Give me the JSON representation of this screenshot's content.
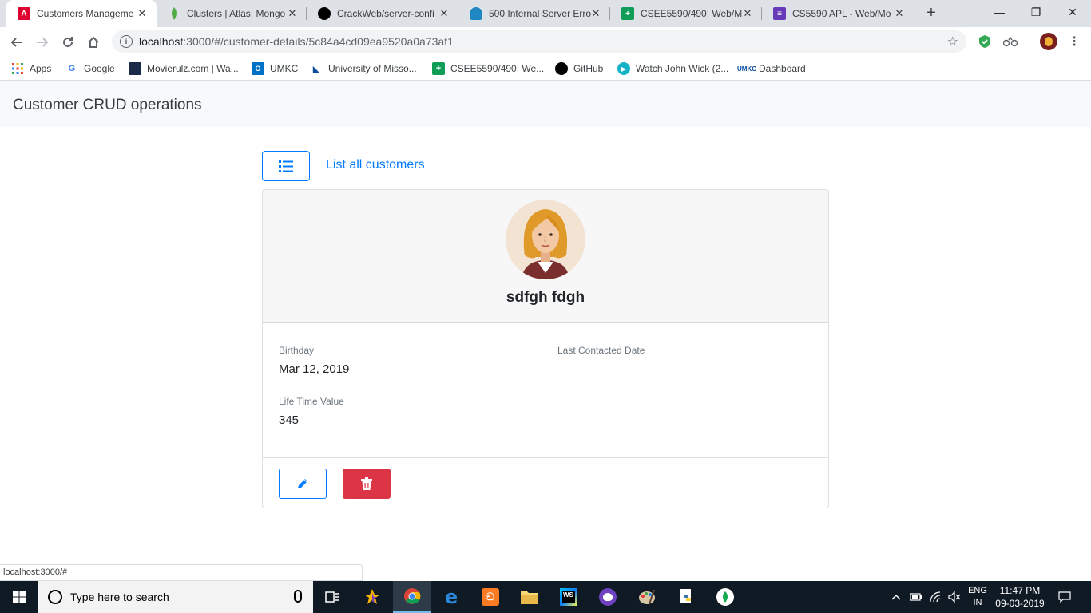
{
  "browser": {
    "tabs": [
      {
        "title": "Customers Manageme",
        "favicon": "angular-icon",
        "color": "#dd0031",
        "active": true
      },
      {
        "title": "Clusters | Atlas: Mongo",
        "favicon": "mongodb-leaf-icon",
        "color": "#4faa41"
      },
      {
        "title": "CrackWeb/server-confi",
        "favicon": "github-icon",
        "color": "#000000"
      },
      {
        "title": "500 Internal Server Erro",
        "favicon": "cloud-icon",
        "color": "#1f88c2"
      },
      {
        "title": "CSEE5590/490: Web/M",
        "favicon": "sheets-icon",
        "color": "#0f9d58"
      },
      {
        "title": "CS5590 APL - Web/Mo",
        "favicon": "forms-icon",
        "color": "#673ab7"
      }
    ],
    "url_host": "localhost",
    "url_rest": ":3000/#/customer-details/5c84a4cd09ea9520a0a73af1",
    "bookmarks": [
      {
        "label": "Apps",
        "icon": "apps-grid-icon"
      },
      {
        "label": "Google",
        "icon": "google-icon"
      },
      {
        "label": "Movierulz.com | Wa...",
        "icon": "movierulz-icon"
      },
      {
        "label": "UMKC",
        "icon": "outlook-icon"
      },
      {
        "label": "University of Misso...",
        "icon": "umkc-icon"
      },
      {
        "label": "CSEE5590/490: We...",
        "icon": "sheets-icon"
      },
      {
        "label": "GitHub",
        "icon": "github-icon"
      },
      {
        "label": "Watch John Wick (2...",
        "icon": "play-icon"
      },
      {
        "label": "Dashboard",
        "icon": "umkc-dashboard-icon"
      }
    ],
    "status_url": "localhost:3000/#"
  },
  "page": {
    "brand": "Customer CRUD operations",
    "list_link": "List all customers",
    "customer": {
      "name": "sdfgh fdgh",
      "birthday_label": "Birthday",
      "birthday": "Mar 12, 2019",
      "last_contacted_label": "Last Contacted Date",
      "last_contacted": "",
      "ltv_label": "Life Time Value",
      "ltv": "345"
    }
  },
  "taskbar": {
    "search_placeholder": "Type here to search",
    "lang_top": "ENG",
    "lang_bottom": "IN",
    "time": "11:47 PM",
    "date": "09-03-2019"
  }
}
